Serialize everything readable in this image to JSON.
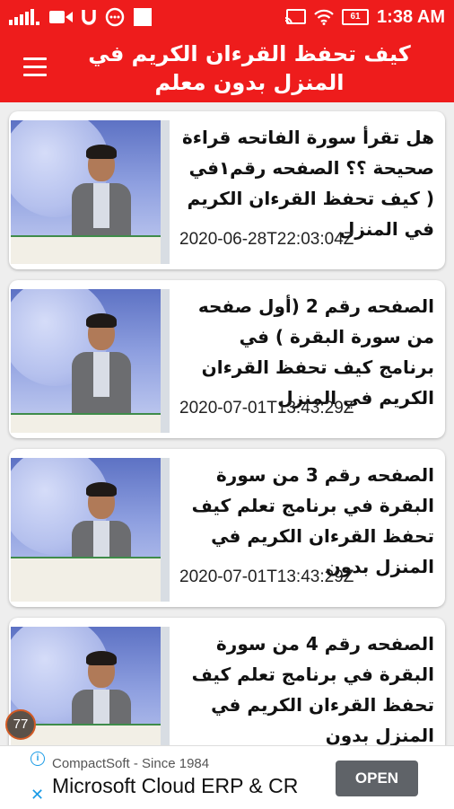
{
  "status_bar": {
    "time": "1:38 AM",
    "battery_level": "61",
    "icons": [
      "signal-icon",
      "video-camera-icon",
      "u-icon",
      "messenger-icon",
      "blank-square-icon",
      "cast-icon",
      "wifi-icon",
      "battery-icon"
    ]
  },
  "app_bar": {
    "title": "كيف تحفظ القرءان الكريم في المنزل بدون معلم",
    "menu_icon": "hamburger-menu-icon"
  },
  "videos": [
    {
      "title": "هل تقرأ سورة الفاتحه قراءة صحيحة ؟؟ الصفحه رقم١في ( كيف تحفظ القرءان الكريم في المنزل",
      "date": "2020-06-28T22:03:04Z"
    },
    {
      "title": "الصفحه رقم 2 (أول صفحه من سورة البقرة ) في برنامج  كيف تحفظ القرءان الكريم في المنزل",
      "date": "2020-07-01T13:43:29Z"
    },
    {
      "title": "الصفحه رقم  3 من  سورة البقرة في برنامج تعلم كيف تحفظ القرءان الكريم في المنزل بدون",
      "date": "2020-07-01T13:43:29Z"
    },
    {
      "title": "الصفحه رقم  4 من  سورة البقرة في برنامج تعلم كيف تحفظ القرءان الكريم في المنزل بدون",
      "date": ""
    }
  ],
  "floating_badge": "77",
  "ad": {
    "sponsor": "CompactSoft - Since 1984",
    "headline": "Microsoft Cloud ERP & CR",
    "cta": "OPEN",
    "accent": "#1a9be6"
  },
  "colors": {
    "brand_red": "#ee1c1c",
    "background": "#eeeeee"
  }
}
